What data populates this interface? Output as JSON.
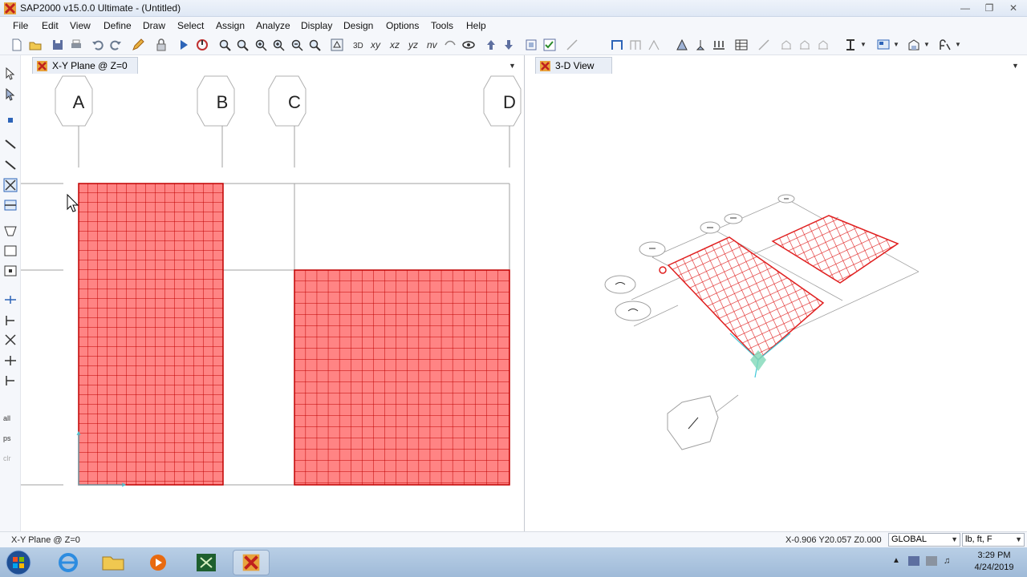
{
  "window": {
    "title": "SAP2000 v15.0.0 Ultimate  - (Untitled)",
    "controls": [
      "minimize-icon",
      "restore-icon",
      "close-icon"
    ]
  },
  "menu": {
    "items": [
      "File",
      "Edit",
      "View",
      "Define",
      "Draw",
      "Select",
      "Assign",
      "Analyze",
      "Display",
      "Design",
      "Options",
      "Tools",
      "Help"
    ]
  },
  "toolbar": {
    "text_buttons": [
      "xy",
      "xz",
      "yz",
      "nv"
    ]
  },
  "panes": {
    "left": {
      "tab_label": "X-Y Plane @ Z=0",
      "grid_labels": [
        "A",
        "B",
        "C",
        "D"
      ]
    },
    "right": {
      "tab_label": "3-D View"
    }
  },
  "left_toolbar": {
    "text_buttons": [
      "all",
      "ps",
      "clr"
    ]
  },
  "statusbar": {
    "left_text": "X-Y Plane @ Z=0",
    "coordinates": "X-0.906  Y20.057  Z0.000",
    "coord_system": "GLOBAL",
    "units": "lb, ft, F"
  },
  "taskbar": {
    "apps": [
      "start-orb-icon",
      "internet-explorer-icon",
      "file-explorer-icon",
      "media-player-icon",
      "spreadsheet-app-icon",
      "sap2000-app-icon"
    ],
    "time": "3:29 PM",
    "date": "4/24/2019"
  },
  "colors": {
    "area_fill": "#ff8484",
    "area_mesh": "#c00000",
    "grid_line": "#a0a0a0"
  }
}
